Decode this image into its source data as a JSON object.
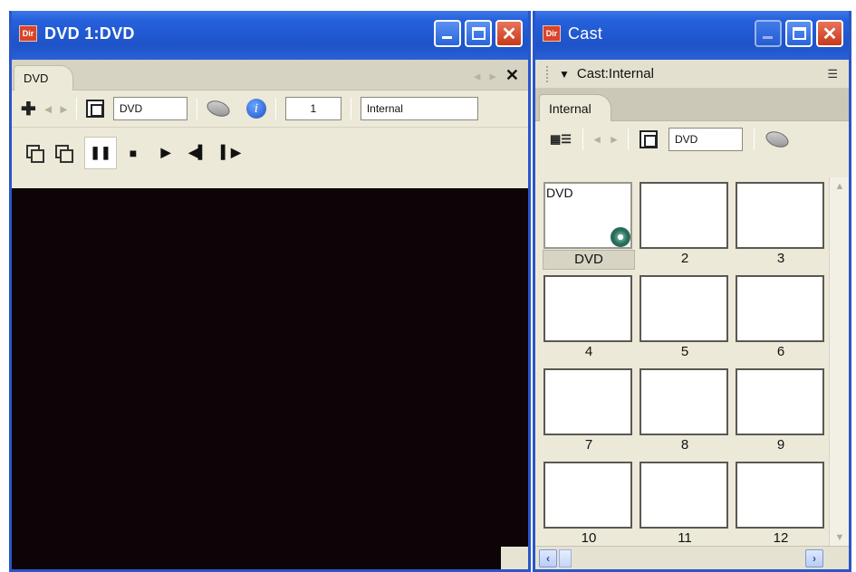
{
  "dvd_window": {
    "title": "DVD 1:DVD",
    "app_icon": "Dir",
    "tab_label": "DVD",
    "toolbar": {
      "member_name": "DVD",
      "member_number": "1",
      "cast_library": "Internal"
    },
    "playback_buttons": [
      "pause",
      "stop",
      "play",
      "step-back",
      "step-forward"
    ]
  },
  "cast_window": {
    "title": "Cast",
    "app_icon": "Dir",
    "header_label": "Cast:Internal",
    "tab_label": "Internal",
    "toolbar": {
      "member_name": "DVD"
    },
    "members": [
      {
        "number": "DVD",
        "thumb_name": "DVD",
        "selected": true
      },
      {
        "number": "2",
        "thumb_name": ""
      },
      {
        "number": "3",
        "thumb_name": ""
      },
      {
        "number": "4",
        "thumb_name": ""
      },
      {
        "number": "5",
        "thumb_name": ""
      },
      {
        "number": "6",
        "thumb_name": ""
      },
      {
        "number": "7",
        "thumb_name": ""
      },
      {
        "number": "8",
        "thumb_name": ""
      },
      {
        "number": "9",
        "thumb_name": ""
      },
      {
        "number": "10",
        "thumb_name": ""
      },
      {
        "number": "11",
        "thumb_name": ""
      },
      {
        "number": "12",
        "thumb_name": ""
      }
    ]
  },
  "colors": {
    "title_bar": "#2560dc",
    "stage_background": "#0d0408",
    "panel_background": "#ece9d8"
  }
}
